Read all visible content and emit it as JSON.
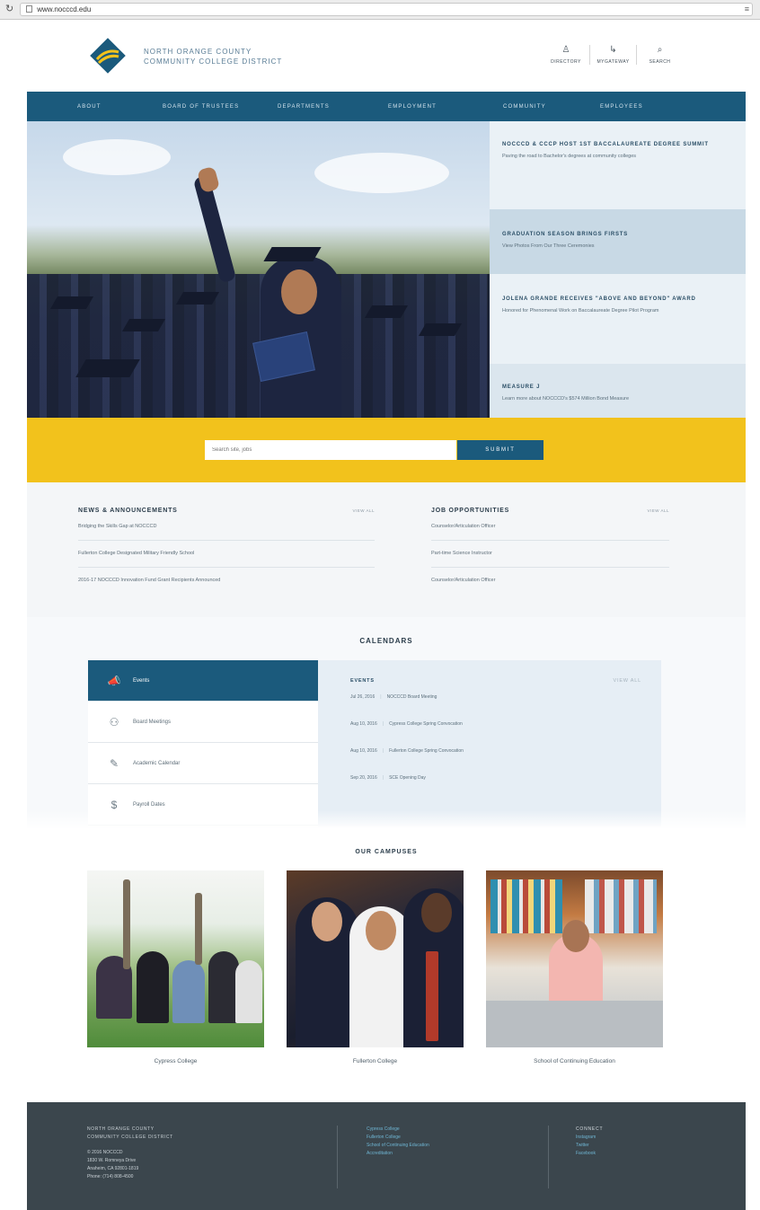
{
  "browser": {
    "url": "www.nocccd.edu"
  },
  "header": {
    "org_line1": "NORTH ORANGE COUNTY",
    "org_line2": "COMMUNITY COLLEGE DISTRICT",
    "util": [
      {
        "label": "DIRECTORY",
        "icon": "person-icon"
      },
      {
        "label": "MYGATEWAY",
        "icon": "gateway-icon"
      },
      {
        "label": "SEARCH",
        "icon": "search-icon"
      }
    ]
  },
  "nav": [
    "ABOUT",
    "BOARD OF TRUSTEES",
    "DEPARTMENTS",
    "EMPLOYMENT",
    "COMMUNITY",
    "EMPLOYEES"
  ],
  "hero_news": [
    {
      "title": "NOCCCD & CCCP HOST 1ST BACCALAUREATE DEGREE SUMMIT",
      "desc": "Paving the road to Bachelor's degrees at community colleges"
    },
    {
      "title": "GRADUATION SEASON BRINGS FIRSTS",
      "desc": "View Photos From Our Three Ceremonies"
    },
    {
      "title": "JOLENA GRANDE RECEIVES \"ABOVE AND BEYOND\" AWARD",
      "desc": "Honored for Phenomenal Work on Baccalaureate Degree Pilot Program"
    },
    {
      "title": "MEASURE J",
      "desc": "Learn more about NOCCCD's $574 Million Bond Measure"
    }
  ],
  "search": {
    "placeholder": "Search site, jobs",
    "button": "SUBMIT"
  },
  "news": {
    "heading": "NEWS & ANNOUNCEMENTS",
    "view_all": "VIEW ALL",
    "items": [
      "Bridging the Skills Gap at NOCCCD",
      "Fullerton College Designated Military Friendly School",
      "2016-17 NOCCCD Innovation Fund Grant Recipients Announced"
    ]
  },
  "jobs": {
    "heading": "JOB OPPORTUNITIES",
    "view_all": "VIEW ALL",
    "items": [
      "Counselor/Articulation Officer",
      "Part-time Science Instructor",
      "Counselor/Articulation Officer"
    ]
  },
  "calendars": {
    "heading": "CALENDARS",
    "tabs": [
      {
        "label": "Events",
        "icon": "megaphone-icon"
      },
      {
        "label": "Board Meetings",
        "icon": "people-icon"
      },
      {
        "label": "Academic Calendar",
        "icon": "pencil-icon"
      },
      {
        "label": "Payroll Dates",
        "icon": "dollar-icon"
      }
    ],
    "panel_title": "EVENTS",
    "panel_view_all": "VIEW ALL",
    "events": [
      {
        "date": "Jul 26, 2016",
        "title": "NOCCCD Board Meeting"
      },
      {
        "date": "Aug 10, 2016",
        "title": "Cypress College Spring Convocation"
      },
      {
        "date": "Aug 10, 2016",
        "title": "Fullerton College Spring Convocation"
      },
      {
        "date": "Sep 20, 2016",
        "title": "SCE Opening Day"
      }
    ]
  },
  "campuses": {
    "heading": "OUR CAMPUSES",
    "items": [
      "Cypress College",
      "Fullerton College",
      "School of Continuing Education"
    ]
  },
  "footer": {
    "org1": "NORTH ORANGE COUNTY",
    "org2": "COMMUNITY COLLEGE DISTRICT",
    "copyright": "© 2016 NOCCCD",
    "address1": "1830 W. Romneya Drive",
    "address2": "Anaheim, CA 92801-1819",
    "phone": "Phone: (714) 808-4500",
    "links": [
      "Cypress College",
      "Fullerton College",
      "School of Continuing Education",
      "Accreditation"
    ],
    "connect": "CONNECT",
    "social": [
      "Instagram",
      "Twitter",
      "Facebook"
    ]
  },
  "colors": {
    "nav": "#1b5a7c",
    "accent": "#f2c21c",
    "footer": "#3b464d"
  }
}
